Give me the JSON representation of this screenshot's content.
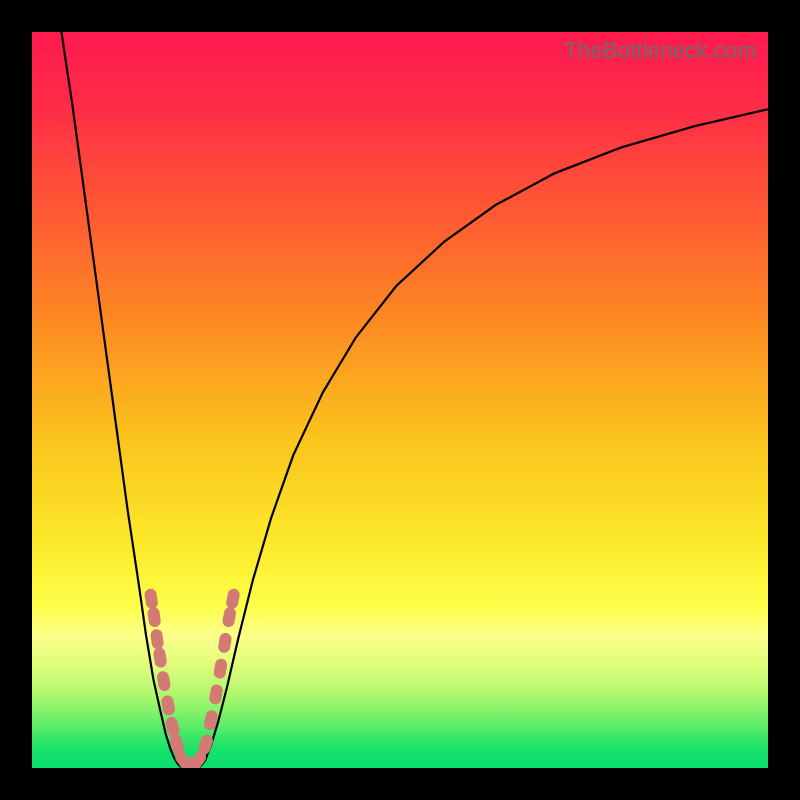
{
  "watermark": "TheBottleneck.com",
  "colors": {
    "gradient_stops": [
      {
        "offset": 0.0,
        "color": "#fe1a4f"
      },
      {
        "offset": 0.1,
        "color": "#fe2c47"
      },
      {
        "offset": 0.25,
        "color": "#fe5b32"
      },
      {
        "offset": 0.4,
        "color": "#fc8c22"
      },
      {
        "offset": 0.55,
        "color": "#fbc31d"
      },
      {
        "offset": 0.7,
        "color": "#fcea2b"
      },
      {
        "offset": 0.78,
        "color": "#feff4a"
      },
      {
        "offset": 0.82,
        "color": "#fcff89"
      },
      {
        "offset": 0.86,
        "color": "#e1fd7a"
      },
      {
        "offset": 0.9,
        "color": "#aef86e"
      },
      {
        "offset": 0.94,
        "color": "#62ed67"
      },
      {
        "offset": 0.975,
        "color": "#17e26b"
      },
      {
        "offset": 1.0,
        "color": "#0adf6c"
      }
    ],
    "curve": "#000000",
    "marker": "#d47a74",
    "background": "#000000"
  },
  "chart_data": {
    "type": "line",
    "title": "",
    "xlabel": "",
    "ylabel": "",
    "xlim": [
      0,
      100
    ],
    "ylim": [
      0,
      100
    ],
    "note": "No visible tick labels; x/y in percent of plot area, y=0 at bottom.",
    "series": [
      {
        "name": "left-branch",
        "x": [
          4.0,
          5.5,
          7.0,
          8.5,
          10.0,
          11.5,
          13.0,
          14.5,
          15.5,
          16.5,
          17.5,
          18.2,
          18.8,
          19.3,
          19.8,
          20.2
        ],
        "y": [
          100,
          90,
          79,
          68,
          57,
          46,
          35,
          25,
          18,
          12,
          7.5,
          4.5,
          2.6,
          1.4,
          0.6,
          0.15
        ]
      },
      {
        "name": "valley-floor",
        "x": [
          20.2,
          20.8,
          21.5,
          22.2,
          22.8
        ],
        "y": [
          0.15,
          0.05,
          0.03,
          0.05,
          0.15
        ]
      },
      {
        "name": "right-branch",
        "x": [
          22.8,
          23.5,
          24.3,
          25.3,
          26.5,
          28.0,
          30.0,
          32.5,
          35.5,
          39.5,
          44.0,
          49.5,
          56.0,
          63.0,
          71.0,
          80.0,
          90.0,
          100.0
        ],
        "y": [
          0.15,
          1.0,
          3.0,
          6.3,
          11.0,
          17.5,
          25.5,
          34.0,
          42.5,
          51.0,
          58.5,
          65.5,
          71.5,
          76.5,
          80.8,
          84.3,
          87.2,
          89.5
        ]
      }
    ],
    "markers": {
      "name": "salmon-dots",
      "shape": "pill",
      "points": [
        {
          "x": 16.2,
          "y": 23.0
        },
        {
          "x": 16.6,
          "y": 20.5
        },
        {
          "x": 17.0,
          "y": 17.5
        },
        {
          "x": 17.4,
          "y": 15.0
        },
        {
          "x": 17.9,
          "y": 11.8
        },
        {
          "x": 18.5,
          "y": 8.5
        },
        {
          "x": 19.1,
          "y": 5.6
        },
        {
          "x": 19.7,
          "y": 3.2
        },
        {
          "x": 20.6,
          "y": 1.0
        },
        {
          "x": 21.6,
          "y": 0.6
        },
        {
          "x": 22.5,
          "y": 1.0
        },
        {
          "x": 23.6,
          "y": 3.2
        },
        {
          "x": 24.3,
          "y": 6.5
        },
        {
          "x": 25.0,
          "y": 10.0
        },
        {
          "x": 25.6,
          "y": 13.5
        },
        {
          "x": 26.2,
          "y": 17.0
        },
        {
          "x": 26.8,
          "y": 20.5
        },
        {
          "x": 27.3,
          "y": 23.0
        }
      ]
    }
  }
}
